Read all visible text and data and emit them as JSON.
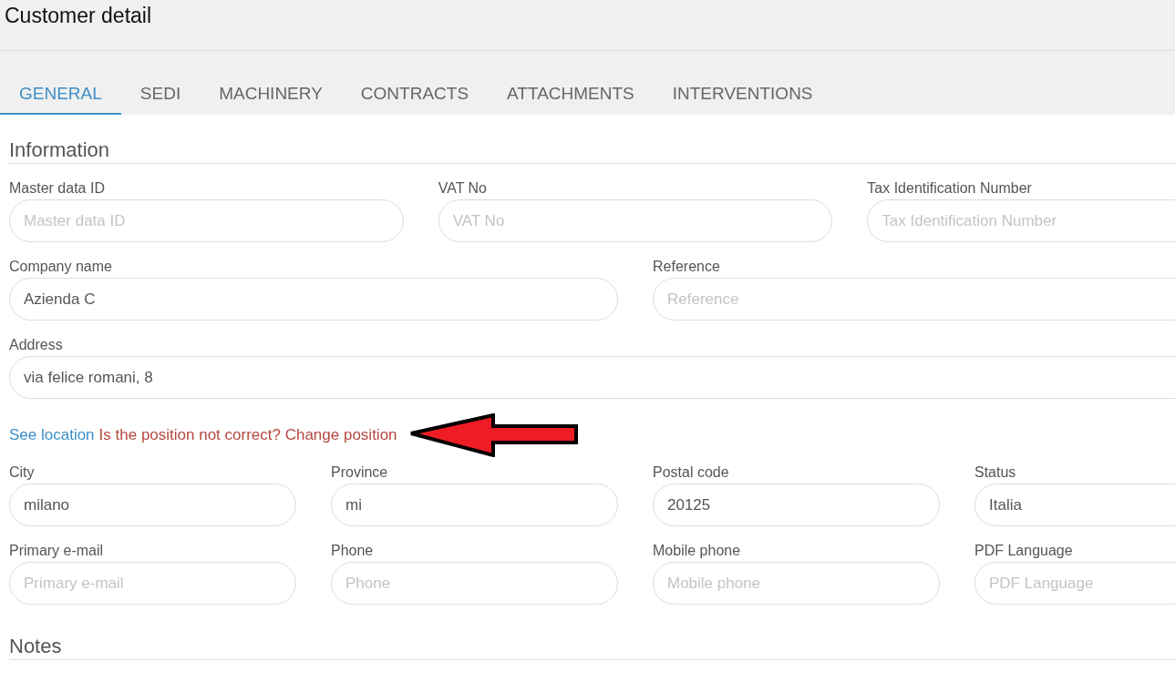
{
  "window": {
    "title": "Customer detail"
  },
  "tabs": [
    {
      "label": "GENERAL",
      "selected": true
    },
    {
      "label": "SEDI",
      "selected": false
    },
    {
      "label": "MACHINERY",
      "selected": false
    },
    {
      "label": "CONTRACTS",
      "selected": false
    },
    {
      "label": "ATTACHMENTS",
      "selected": false
    },
    {
      "label": "INTERVENTIONS",
      "selected": false
    }
  ],
  "information": {
    "heading": "Information",
    "rows": [
      {
        "fields": [
          {
            "label": "Master data ID",
            "placeholder": "Master data ID"
          },
          {
            "label": "VAT No",
            "placeholder": "VAT No"
          },
          {
            "label": "Tax Identification Number",
            "placeholder": "Tax Identification Number"
          }
        ]
      },
      {
        "fields": [
          {
            "label": "Company name",
            "value": "Azienda C"
          },
          {
            "label": "Reference",
            "placeholder": "Reference"
          }
        ]
      },
      {
        "fields": [
          {
            "label": "Address",
            "value": "via felice romani, 8"
          }
        ]
      },
      {
        "kind": "links",
        "links": [
          {
            "text": "See location",
            "kind": "primary"
          },
          {
            "text": "Is the position not correct? Change position",
            "kind": "warning"
          }
        ]
      },
      {
        "fields": [
          {
            "label": "City",
            "value": "milano"
          },
          {
            "label": "Province",
            "value": "mi"
          },
          {
            "label": "Postal code",
            "value": "20125"
          },
          {
            "label": "Status",
            "value": "Italia"
          }
        ]
      },
      {
        "fields": [
          {
            "label": "Primary e-mail",
            "placeholder": "Primary e-mail"
          },
          {
            "label": "Phone",
            "placeholder": "Phone"
          },
          {
            "label": "Mobile phone",
            "placeholder": "Mobile phone"
          },
          {
            "label": "PDF Language",
            "placeholder": "PDF Language"
          }
        ]
      }
    ]
  },
  "notes": {
    "heading": "Notes"
  }
}
